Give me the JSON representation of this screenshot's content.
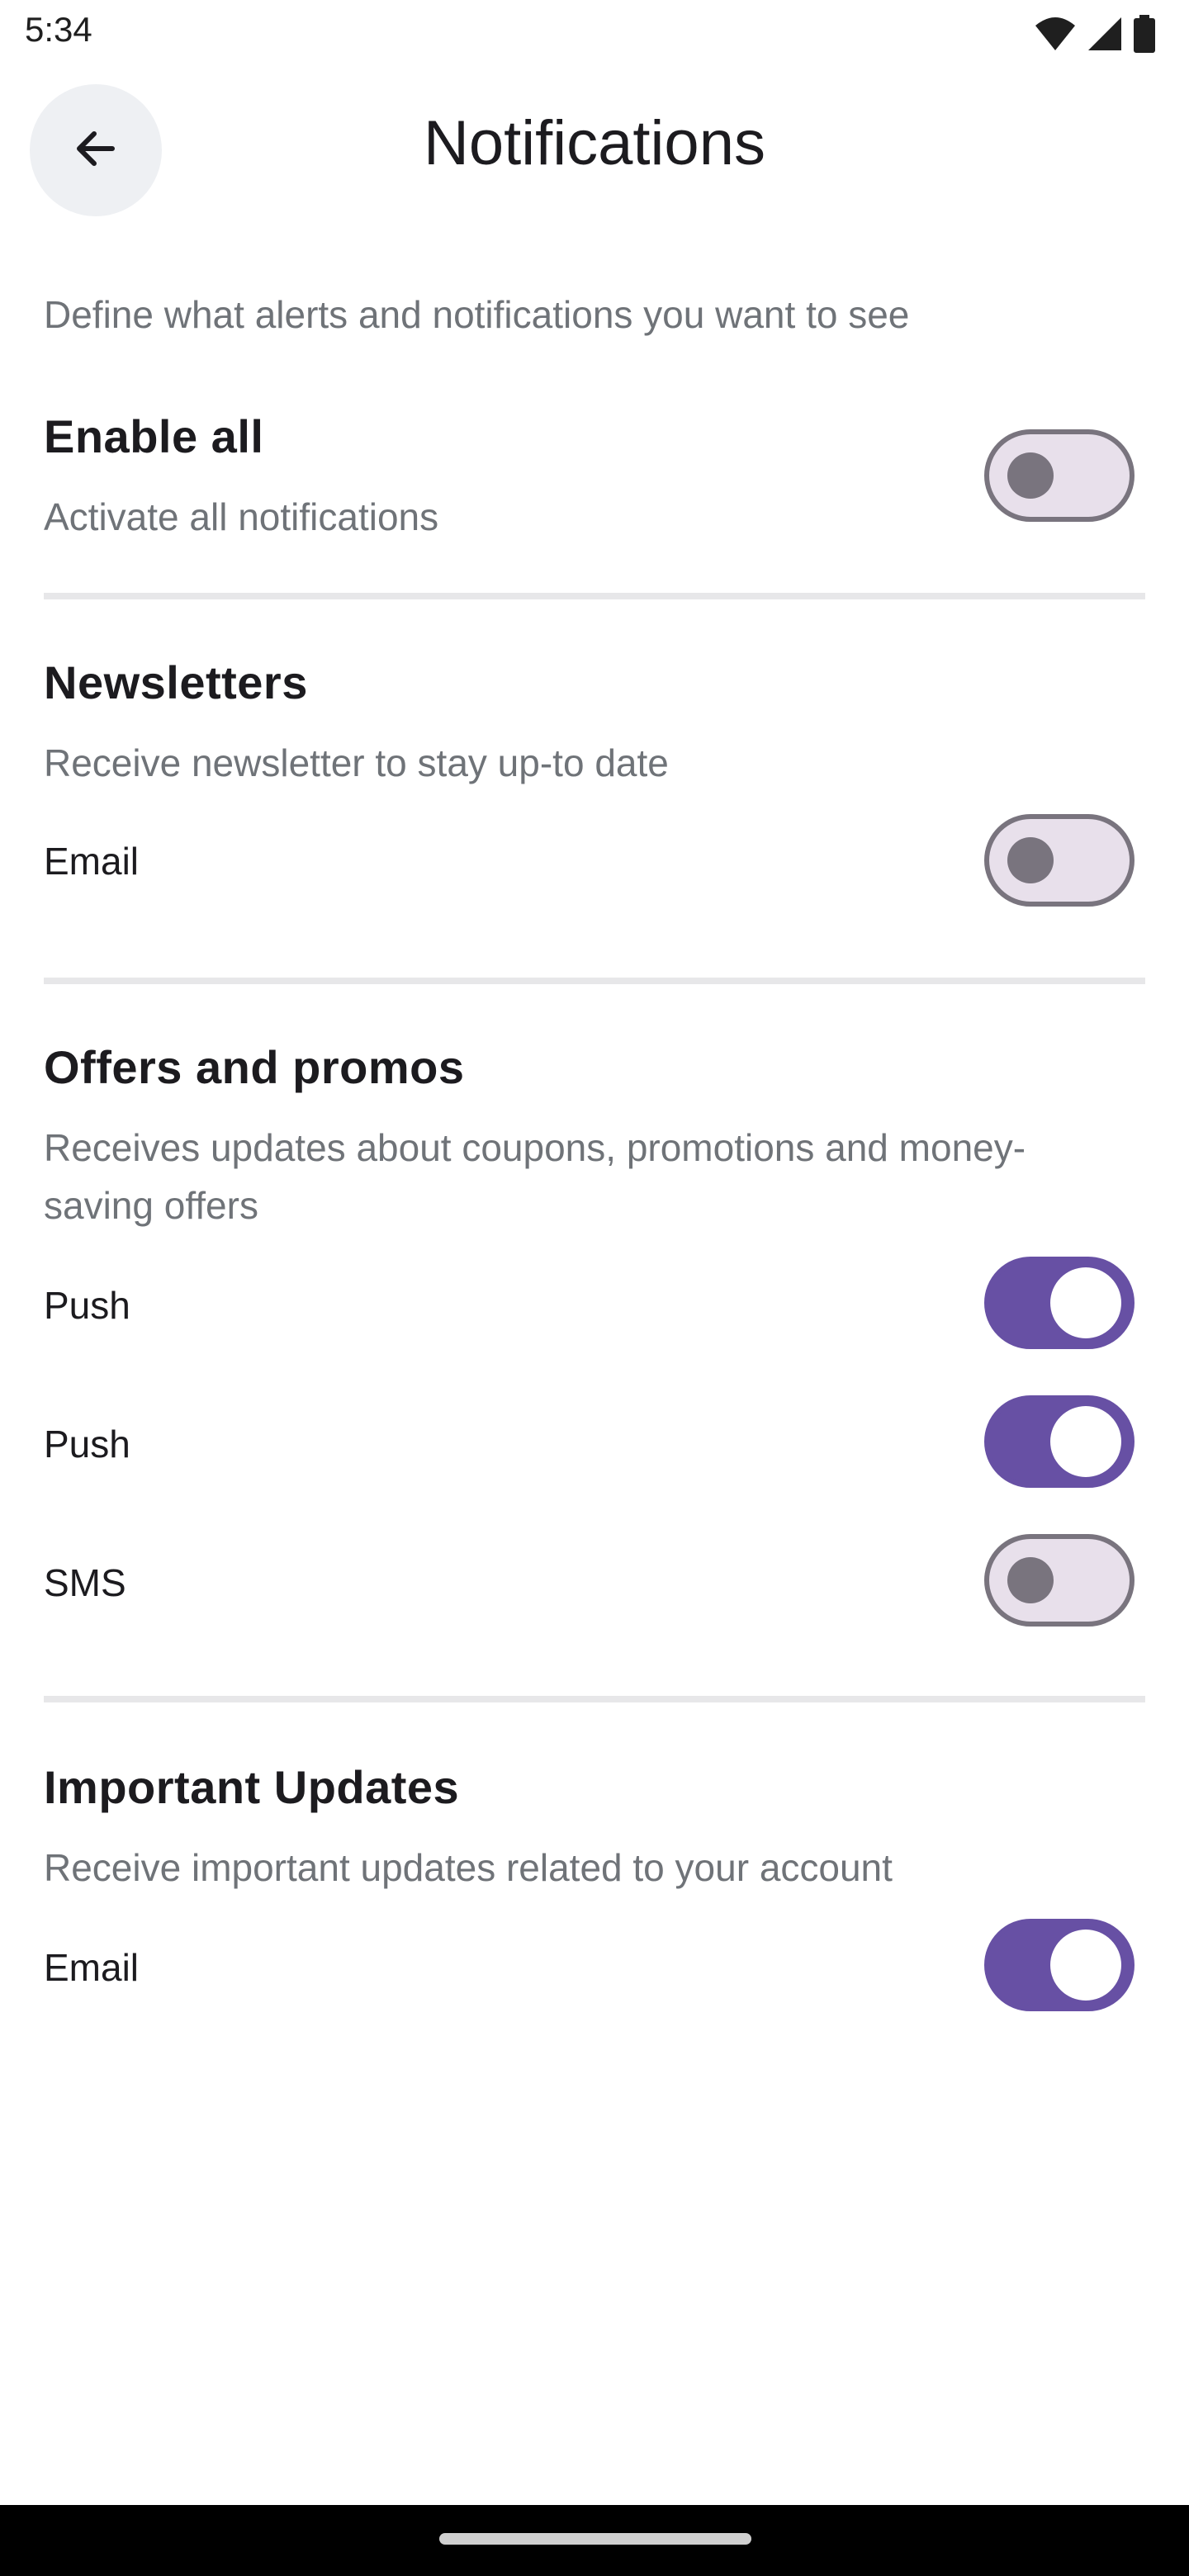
{
  "status_bar": {
    "time": "5:34",
    "icons": [
      "wifi-icon",
      "cell-signal-icon",
      "battery-icon"
    ]
  },
  "header": {
    "back_icon": "arrow-back-icon",
    "title": "Notifications"
  },
  "intro": "Define what alerts and notifications you want to see",
  "enable_all": {
    "title": "Enable all",
    "description": "Activate all notifications",
    "toggle_on": false
  },
  "sections": [
    {
      "title": "Newsletters",
      "description": "Receive newsletter to stay up-to date",
      "rows": [
        {
          "label": "Email",
          "toggle_on": false
        }
      ]
    },
    {
      "title": "Offers and promos",
      "description": "Receives updates about coupons, promotions and money-saving offers",
      "rows": [
        {
          "label": "Push",
          "toggle_on": true
        },
        {
          "label": "Push",
          "toggle_on": true
        },
        {
          "label": "SMS",
          "toggle_on": false
        }
      ]
    },
    {
      "title": "Important Updates",
      "description": "Receive important updates related to your account",
      "rows": [
        {
          "label": "Email",
          "toggle_on": true
        }
      ]
    }
  ],
  "colors": {
    "accent": "#6750a4",
    "toggle_off_track": "#e8e0eb",
    "toggle_off_outline": "#79747e",
    "secondary_text": "#6f7378",
    "back_button_bg": "#eef0f3"
  }
}
